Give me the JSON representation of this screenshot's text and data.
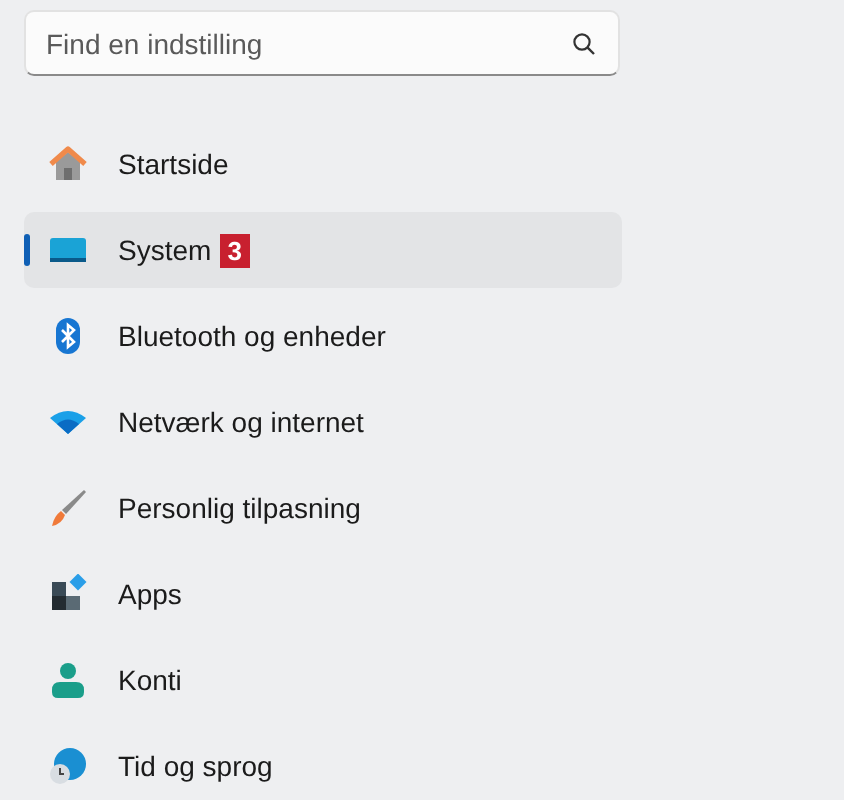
{
  "search": {
    "placeholder": "Find en indstilling"
  },
  "nav_items": [
    {
      "kind": "home",
      "label": "Startside",
      "selected": false
    },
    {
      "kind": "system",
      "label": "System",
      "selected": true,
      "badge": "3"
    },
    {
      "kind": "bluetooth",
      "label": "Bluetooth og enheder",
      "selected": false
    },
    {
      "kind": "network",
      "label": "Netværk og internet",
      "selected": false
    },
    {
      "kind": "personalization",
      "label": "Personlig tilpasning",
      "selected": false
    },
    {
      "kind": "apps",
      "label": "Apps",
      "selected": false
    },
    {
      "kind": "accounts",
      "label": "Konti",
      "selected": false
    },
    {
      "kind": "time",
      "label": "Tid og sprog",
      "selected": false
    }
  ]
}
